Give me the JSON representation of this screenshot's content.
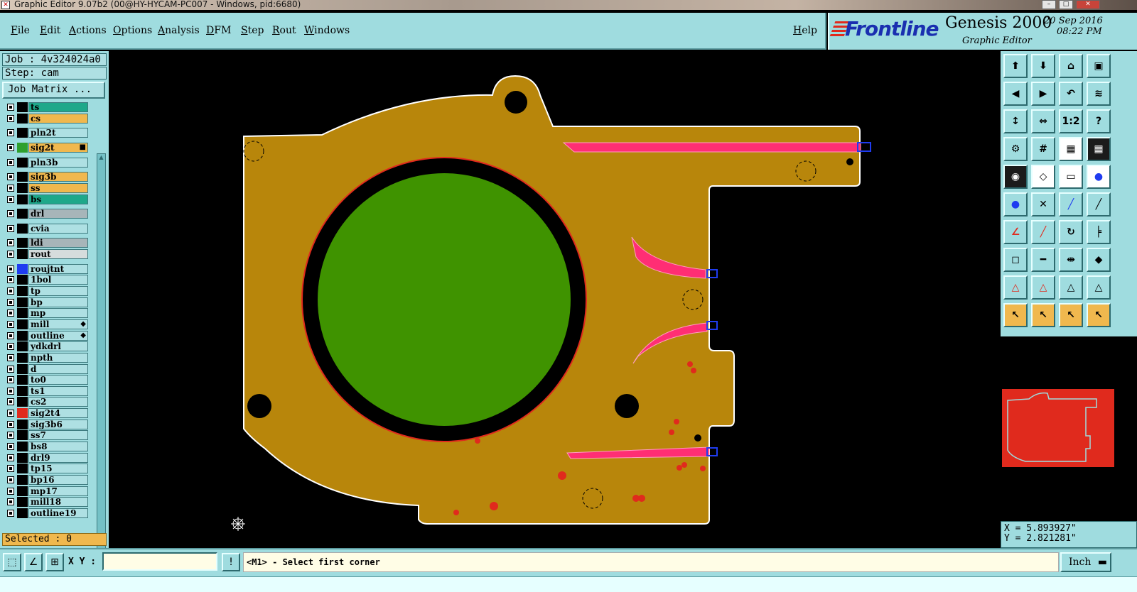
{
  "window": {
    "title": "Graphic Editor 9.07b2 (00@HY-HYCAM-PC007 - Windows, pid:6680)"
  },
  "menu": {
    "items": [
      "File",
      "Edit",
      "Actions",
      "Options",
      "Analysis",
      "DFM",
      "Step",
      "Rout",
      "Windows"
    ],
    "help": "Help"
  },
  "brand": {
    "logo": "Frontline",
    "product": "Genesis 2000",
    "subtitle": "Graphic Editor",
    "date": "20 Sep 2016",
    "time": "08:22 PM"
  },
  "job": {
    "job_line": "Job : 4v324024a0",
    "step_line": "Step: cam",
    "matrix_button": "Job Matrix ..."
  },
  "layers": [
    {
      "name": "ts",
      "color": "#1ea88a",
      "swatch": "#000000",
      "mark": ""
    },
    {
      "name": "cs",
      "color": "#f0b84e",
      "swatch": "#000000",
      "mark": ""
    },
    {
      "name": "pln2t",
      "color": "#aee0e3",
      "swatch": "#000000",
      "mark": ""
    },
    {
      "name": "sig2t",
      "color": "#f0b84e",
      "swatch": "#2ea02e",
      "mark": "■"
    },
    {
      "name": "pln3b",
      "color": "#aee0e3",
      "swatch": "#000000",
      "mark": ""
    },
    {
      "name": "sig3b",
      "color": "#f0b84e",
      "swatch": "#000000",
      "mark": ""
    },
    {
      "name": "ss",
      "color": "#f0b84e",
      "swatch": "#000000",
      "mark": ""
    },
    {
      "name": "bs",
      "color": "#1ea88a",
      "swatch": "#000000",
      "mark": ""
    },
    {
      "name": "drl",
      "color": "#a7b5b9",
      "swatch": "#000000",
      "mark": ""
    },
    {
      "name": "cvia",
      "color": "#aee0e3",
      "swatch": "#000000",
      "mark": ""
    },
    {
      "name": "ldi",
      "color": "#a7b5b9",
      "swatch": "#000000",
      "mark": ""
    },
    {
      "name": "rout",
      "color": "#d6dcdc",
      "swatch": "#000000",
      "mark": ""
    },
    {
      "name": "roujtnt",
      "color": "#aee0e3",
      "swatch": "#1f3cf0",
      "mark": ""
    },
    {
      "name": "1bol",
      "color": "#aee0e3",
      "swatch": "#000000",
      "mark": ""
    },
    {
      "name": "tp",
      "color": "#aee0e3",
      "swatch": "#000000",
      "mark": ""
    },
    {
      "name": "bp",
      "color": "#aee0e3",
      "swatch": "#000000",
      "mark": ""
    },
    {
      "name": "mp",
      "color": "#aee0e3",
      "swatch": "#000000",
      "mark": ""
    },
    {
      "name": "mill",
      "color": "#aee0e3",
      "swatch": "#000000",
      "mark": "◆"
    },
    {
      "name": "outline",
      "color": "#aee0e3",
      "swatch": "#000000",
      "mark": "◆"
    },
    {
      "name": "ydkdrl",
      "color": "#aee0e3",
      "swatch": "#000000",
      "mark": ""
    },
    {
      "name": "npth",
      "color": "#aee0e3",
      "swatch": "#000000",
      "mark": ""
    },
    {
      "name": "d",
      "color": "#aee0e3",
      "swatch": "#000000",
      "mark": ""
    },
    {
      "name": "to0",
      "color": "#aee0e3",
      "swatch": "#000000",
      "mark": ""
    },
    {
      "name": "ts1",
      "color": "#aee0e3",
      "swatch": "#000000",
      "mark": ""
    },
    {
      "name": "cs2",
      "color": "#aee0e3",
      "swatch": "#000000",
      "mark": ""
    },
    {
      "name": "sig2t4",
      "color": "#aee0e3",
      "swatch": "#e02a1d",
      "mark": ""
    },
    {
      "name": "sig3b6",
      "color": "#aee0e3",
      "swatch": "#000000",
      "mark": ""
    },
    {
      "name": "ss7",
      "color": "#aee0e3",
      "swatch": "#000000",
      "mark": ""
    },
    {
      "name": "bs8",
      "color": "#aee0e3",
      "swatch": "#000000",
      "mark": ""
    },
    {
      "name": "drl9",
      "color": "#aee0e3",
      "swatch": "#000000",
      "mark": ""
    },
    {
      "name": "tp15",
      "color": "#aee0e3",
      "swatch": "#000000",
      "mark": ""
    },
    {
      "name": "bp16",
      "color": "#aee0e3",
      "swatch": "#000000",
      "mark": ""
    },
    {
      "name": "mp17",
      "color": "#aee0e3",
      "swatch": "#000000",
      "mark": ""
    },
    {
      "name": "mill18",
      "color": "#aee0e3",
      "swatch": "#000000",
      "mark": ""
    },
    {
      "name": "outline19",
      "color": "#aee0e3",
      "swatch": "#000000",
      "mark": ""
    }
  ],
  "selected": "Selected : 0",
  "coords": {
    "x": "X = 5.893927\"",
    "y": "Y = 2.821281\""
  },
  "bottom": {
    "xy_label": "X Y :",
    "xy_value": "",
    "prompt": "<M1> - Select first corner",
    "units": "Inch"
  },
  "toolbox": {
    "icons": [
      "move-up-icon",
      "move-down-icon",
      "home-icon",
      "window-icon",
      "pan-left-icon",
      "pan-right-icon",
      "undo-zoom-icon",
      "redraw-icon",
      "fit-height-icon",
      "fit-screen-icon",
      "scale-1-2-icon",
      "help-icon",
      "settings-icon",
      "grid-icon",
      "layers-a-icon",
      "layers-b-icon",
      "camera-icon",
      "draw-icon",
      "ruler-icon",
      "pad-icon",
      "connect-icon",
      "delete-icon",
      "edge-a-icon",
      "edge-b-icon",
      "angle-a-icon",
      "angle-b-icon",
      "rotate-icon",
      "mirror-icon",
      "copy-icon",
      "line-icon",
      "dimension-icon",
      "shapes-icon",
      "tri-a-icon",
      "tri-b-icon",
      "tri-c-icon",
      "tri-d-icon",
      "pointer-a-icon",
      "pointer-b-icon",
      "pointer-c-icon",
      "pointer-d-icon"
    ],
    "labels": [
      "1:2",
      "?"
    ]
  }
}
